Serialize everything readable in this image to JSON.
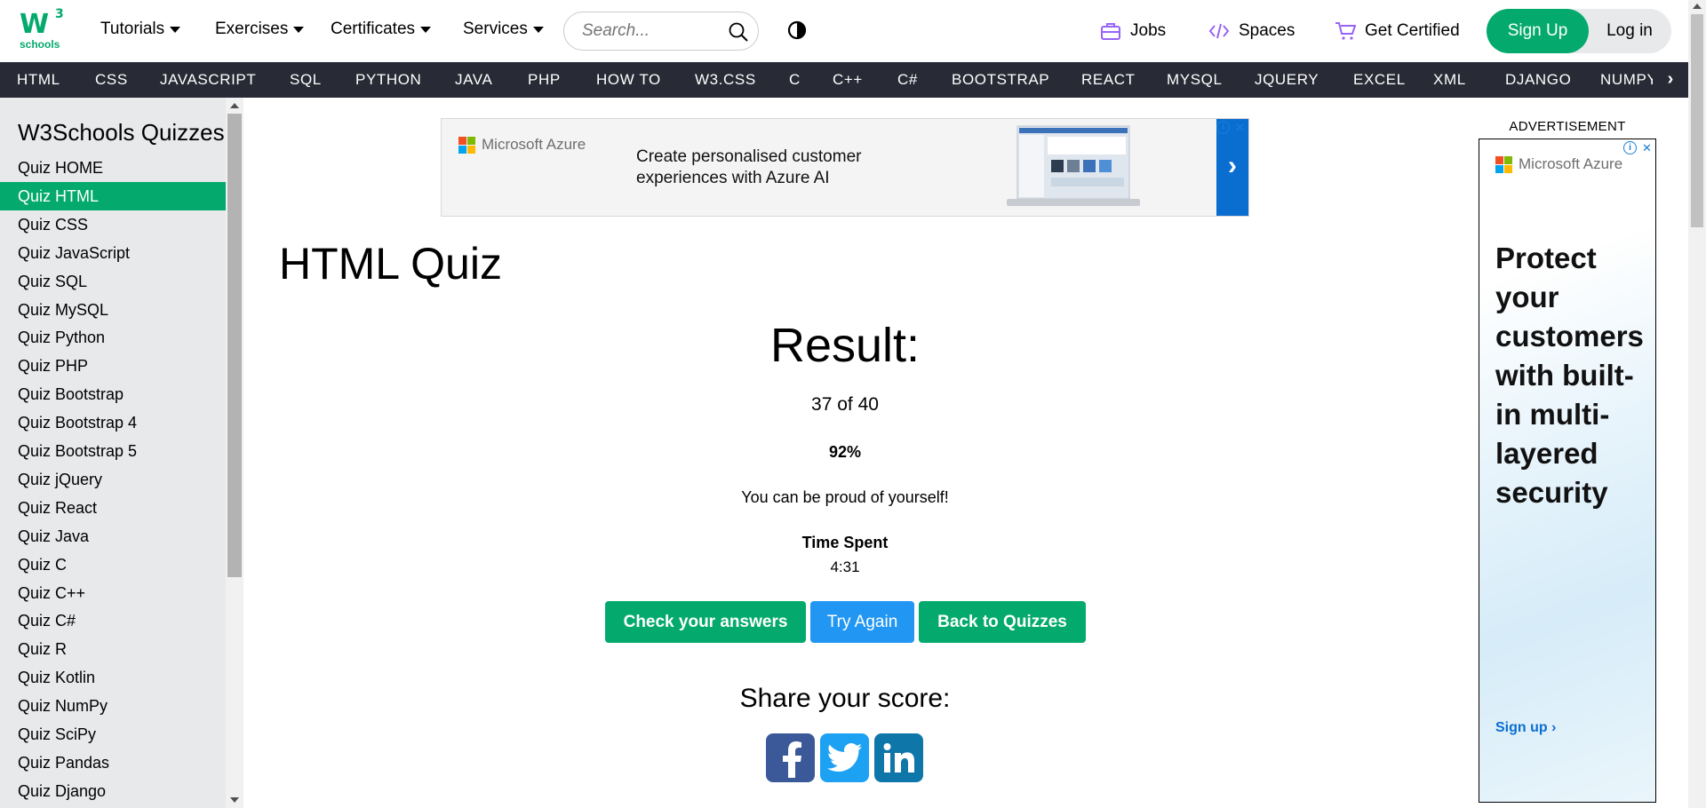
{
  "brand": {
    "logo_main": "W",
    "logo_sup": "3",
    "logo_sub": "schools"
  },
  "topnav": {
    "menus": [
      {
        "label": "Tutorials"
      },
      {
        "label": "Exercises"
      },
      {
        "label": "Certificates"
      },
      {
        "label": "Services"
      }
    ],
    "search_placeholder": "Search...",
    "right_links": [
      {
        "label": "Jobs",
        "icon": "briefcase-icon"
      },
      {
        "label": "Spaces",
        "icon": "code-icon"
      },
      {
        "label": "Get Certified",
        "icon": "cart-icon"
      }
    ],
    "signup_label": "Sign Up",
    "login_label": "Log in"
  },
  "subjects": [
    "HTML",
    "CSS",
    "JAVASCRIPT",
    "SQL",
    "PYTHON",
    "JAVA",
    "PHP",
    "HOW TO",
    "W3.CSS",
    "C",
    "C++",
    "C#",
    "BOOTSTRAP",
    "REACT",
    "MYSQL",
    "JQUERY",
    "EXCEL",
    "XML",
    "DJANGO",
    "NUMPY"
  ],
  "sidebar": {
    "title": "W3Schools Quizzes",
    "items": [
      "Quiz HOME",
      "Quiz HTML",
      "Quiz CSS",
      "Quiz JavaScript",
      "Quiz SQL",
      "Quiz MySQL",
      "Quiz Python",
      "Quiz PHP",
      "Quiz Bootstrap",
      "Quiz Bootstrap 4",
      "Quiz Bootstrap 5",
      "Quiz jQuery",
      "Quiz React",
      "Quiz Java",
      "Quiz C",
      "Quiz C++",
      "Quiz C#",
      "Quiz R",
      "Quiz Kotlin",
      "Quiz NumPy",
      "Quiz SciPy",
      "Quiz Pandas",
      "Quiz Django"
    ],
    "active_index": 1
  },
  "top_ad": {
    "brand": "Microsoft Azure",
    "copy": "Create personalised customer experiences with Azure AI"
  },
  "side_ad": {
    "label": "ADVERTISEMENT",
    "brand": "Microsoft Azure",
    "headline": "Protect your customers with built-in multi-layered security",
    "cta": "Sign up ›"
  },
  "main": {
    "title": "HTML Quiz",
    "result_heading": "Result:",
    "score": "37 of 40",
    "percent": "92%",
    "message": "You can be proud of yourself!",
    "time_label": "Time Spent",
    "time_value": "4:31",
    "buttons": {
      "check": "Check your answers",
      "retry": "Try Again",
      "back": "Back to Quizzes"
    },
    "share_heading": "Share your score:"
  },
  "colors": {
    "brand_green": "#04AA6D",
    "nav_dark": "#282A35",
    "sidebar_bg": "#E7E9EB",
    "try_again_blue": "#2196F3",
    "facebook": "#3B5998",
    "twitter": "#1DA1F2",
    "linkedin": "#0E76A8"
  }
}
